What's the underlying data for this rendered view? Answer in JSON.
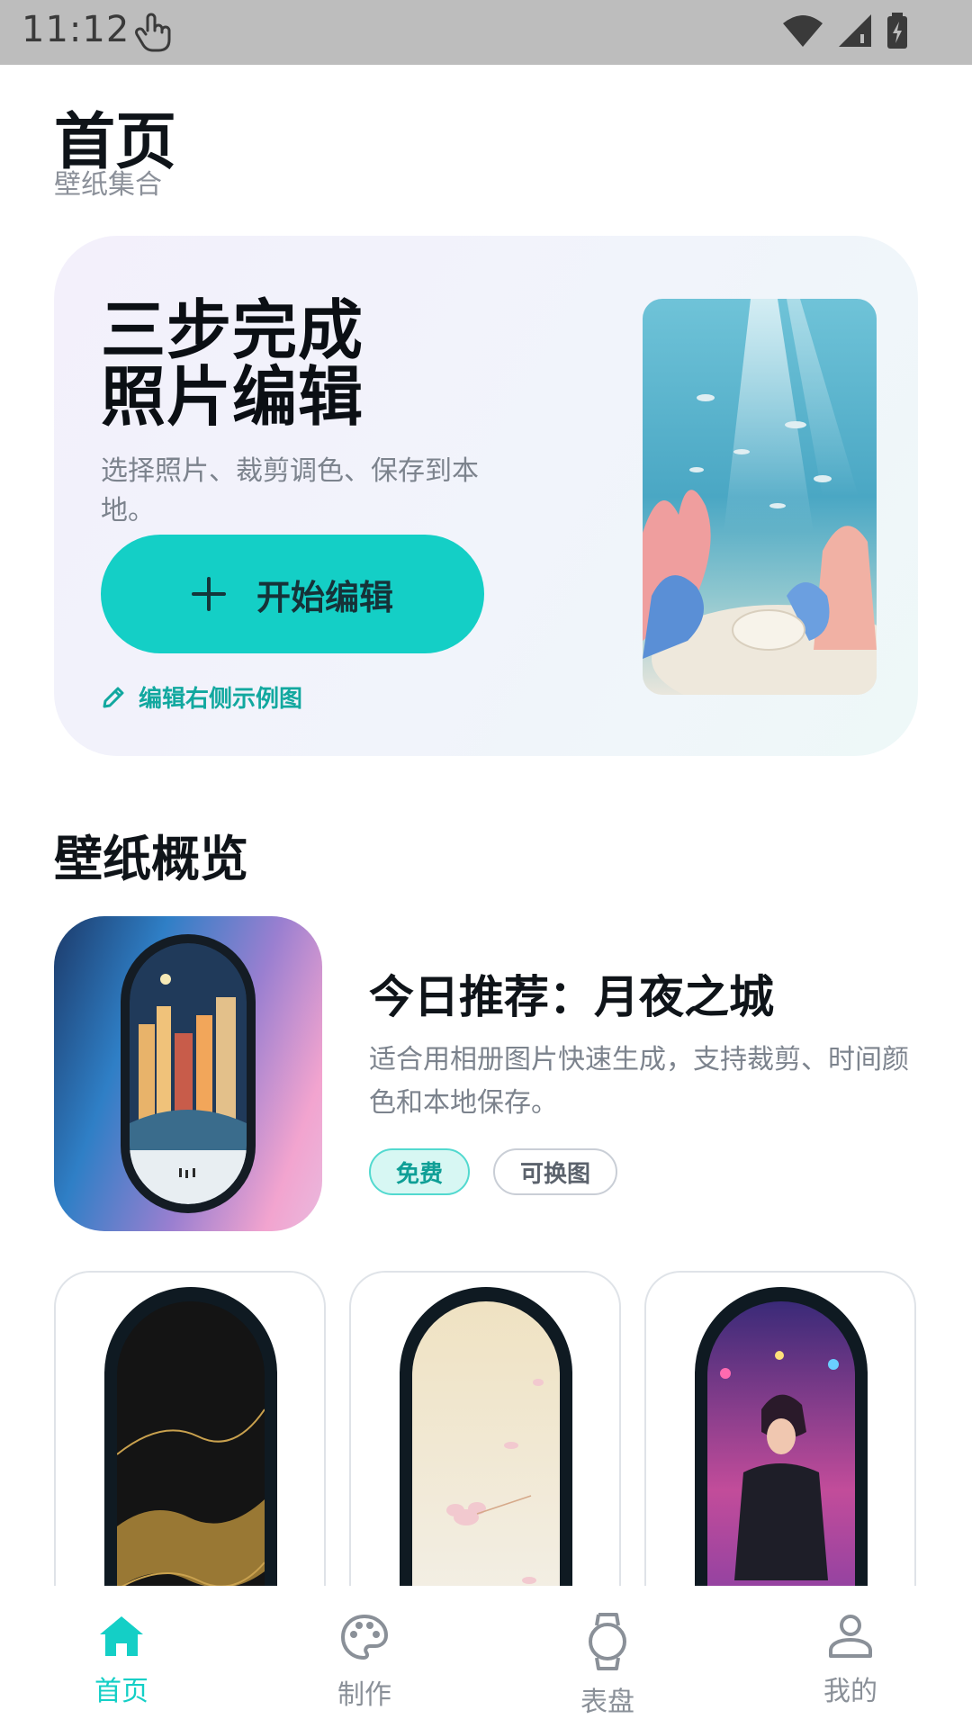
{
  "status": {
    "time": "11:12"
  },
  "header": {
    "title": "首页",
    "subtitle": "壁纸集合"
  },
  "hero": {
    "title_line1": "三步完成",
    "title_line2": "照片编辑",
    "desc": "选择照片、裁剪调色、保存到本地。",
    "button_label": "开始编辑",
    "link_label": "编辑右侧示例图"
  },
  "section": {
    "title": "壁纸概览"
  },
  "featured": {
    "title": "今日推荐：月夜之城",
    "desc": "适合用相册图片快速生成，支持裁剪、时间颜色和本地保存。",
    "tags": [
      "免费",
      "可换图"
    ]
  },
  "tabbar": {
    "items": [
      {
        "label": "首页",
        "icon": "home-icon"
      },
      {
        "label": "制作",
        "icon": "palette-icon"
      },
      {
        "label": "表盘",
        "icon": "watch-icon"
      },
      {
        "label": "我的",
        "icon": "user-icon"
      }
    ],
    "active_index": 0
  },
  "colors": {
    "accent": "#14cfc6",
    "text": "#0f1419",
    "muted": "#7c838d"
  }
}
